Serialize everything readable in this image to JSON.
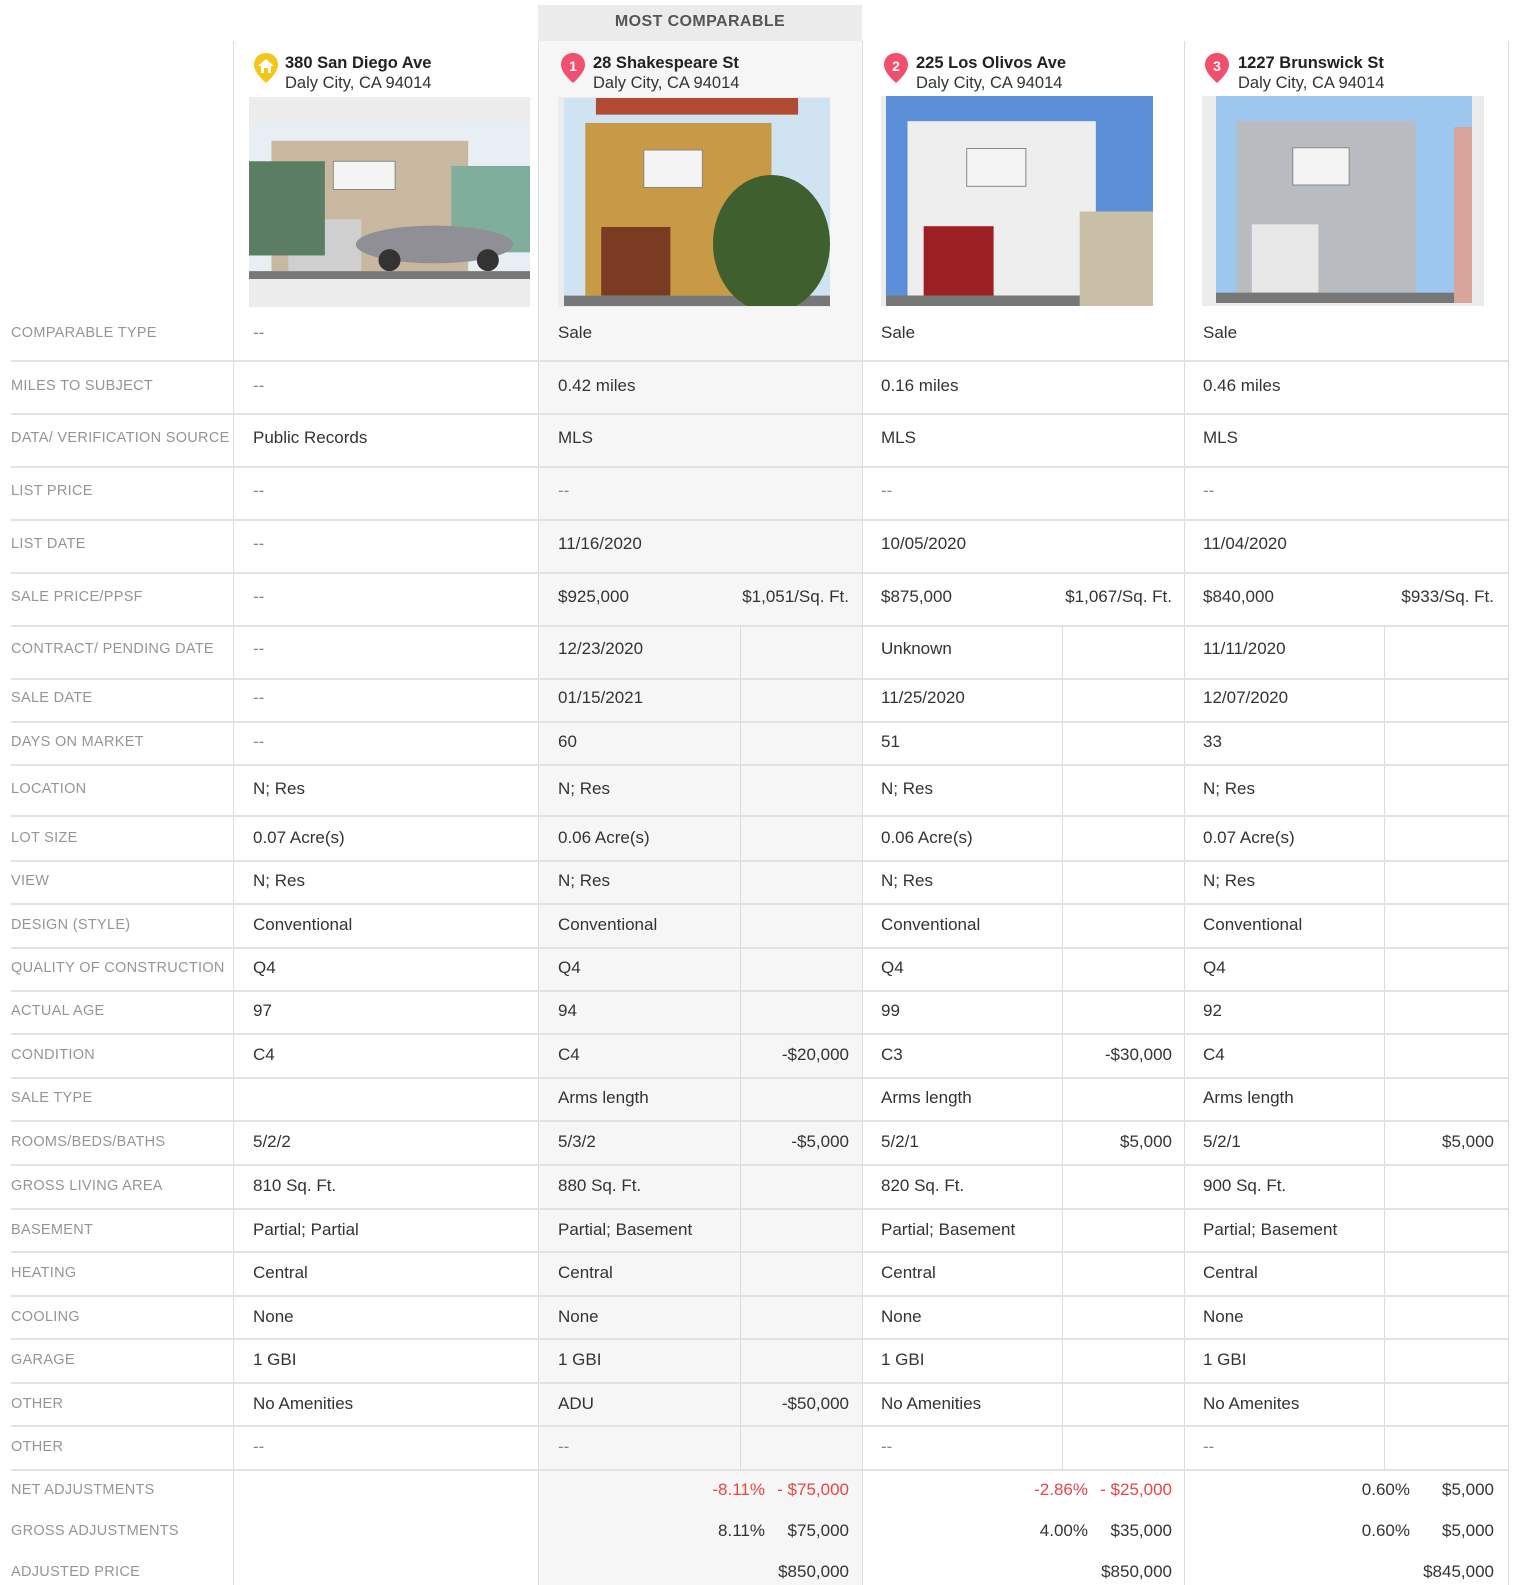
{
  "highlight_label": "MOST COMPARABLE",
  "properties": [
    {
      "marker": "home",
      "street": "380 San Diego Ave",
      "city": "Daly City, CA 94014",
      "photo": "photo of gray house with car parked in front",
      "marker_color": "#f5c518"
    },
    {
      "marker": "1",
      "street": "28 Shakespeare St",
      "city": "Daly City, CA 94014",
      "photo": "photo of tan stucco house with tree",
      "marker_color": "#f0506e"
    },
    {
      "marker": "2",
      "street": "225 Los Olivos Ave",
      "city": "Daly City, CA 94014",
      "photo": "photo of white stucco house with red garage",
      "marker_color": "#f0506e"
    },
    {
      "marker": "3",
      "street": "1227 Brunswick St",
      "city": "Daly City, CA 94014",
      "photo": "photo of gray two-story house",
      "marker_color": "#f0506e"
    }
  ],
  "rows": [
    {
      "label": "COMPARABLE TYPE",
      "cells": [
        {
          "v": "--"
        },
        {
          "v": "Sale"
        },
        {
          "v": "Sale"
        },
        {
          "v": "Sale"
        }
      ],
      "split": false
    },
    {
      "label": "MILES TO SUBJECT",
      "cells": [
        {
          "v": "--"
        },
        {
          "v": "0.42 miles"
        },
        {
          "v": "0.16 miles"
        },
        {
          "v": "0.46 miles"
        }
      ],
      "split": false
    },
    {
      "label": "DATA/ VERIFICATION SOURCE",
      "cells": [
        {
          "v": "Public Records"
        },
        {
          "v": "MLS"
        },
        {
          "v": "MLS"
        },
        {
          "v": "MLS"
        }
      ],
      "split": false
    },
    {
      "label": "LIST PRICE",
      "cells": [
        {
          "v": "--"
        },
        {
          "v": "--"
        },
        {
          "v": "--"
        },
        {
          "v": "--"
        }
      ],
      "split": false
    },
    {
      "label": "LIST DATE",
      "cells": [
        {
          "v": "--"
        },
        {
          "v": "11/16/2020"
        },
        {
          "v": "10/05/2020"
        },
        {
          "v": "11/04/2020"
        }
      ],
      "split": false
    },
    {
      "label": "SALE PRICE/PPSF",
      "cells": [
        {
          "v": "--"
        },
        {
          "v": "$925,000",
          "a": "$1,051/Sq. Ft."
        },
        {
          "v": "$875,000",
          "a": "$1,067/Sq. Ft."
        },
        {
          "v": "$840,000",
          "a": "$933/Sq. Ft."
        }
      ],
      "split": false
    },
    {
      "label": "CONTRACT/ PENDING DATE",
      "cells": [
        {
          "v": "--"
        },
        {
          "v": "12/23/2020"
        },
        {
          "v": "Unknown"
        },
        {
          "v": "11/11/2020"
        }
      ],
      "split": true
    },
    {
      "label": "SALE DATE",
      "cells": [
        {
          "v": "--"
        },
        {
          "v": "01/15/2021"
        },
        {
          "v": "11/25/2020"
        },
        {
          "v": "12/07/2020"
        }
      ],
      "split": true
    },
    {
      "label": "DAYS ON MARKET",
      "cells": [
        {
          "v": "--"
        },
        {
          "v": "60"
        },
        {
          "v": "51"
        },
        {
          "v": "33"
        }
      ],
      "split": true
    },
    {
      "label": "LOCATION",
      "cells": [
        {
          "v": "N; Res"
        },
        {
          "v": "N; Res"
        },
        {
          "v": "N; Res"
        },
        {
          "v": "N; Res"
        }
      ],
      "split": true
    },
    {
      "label": "LOT SIZE",
      "cells": [
        {
          "v": "0.07 Acre(s)"
        },
        {
          "v": "0.06 Acre(s)"
        },
        {
          "v": "0.06 Acre(s)"
        },
        {
          "v": "0.07 Acre(s)"
        }
      ],
      "split": true
    },
    {
      "label": "VIEW",
      "cells": [
        {
          "v": "N; Res"
        },
        {
          "v": "N; Res"
        },
        {
          "v": "N; Res"
        },
        {
          "v": "N; Res"
        }
      ],
      "split": true
    },
    {
      "label": "DESIGN (STYLE)",
      "cells": [
        {
          "v": "Conventional"
        },
        {
          "v": "Conventional"
        },
        {
          "v": "Conventional"
        },
        {
          "v": "Conventional"
        }
      ],
      "split": true
    },
    {
      "label": "QUALITY OF CONSTRUCTION",
      "cells": [
        {
          "v": "Q4"
        },
        {
          "v": "Q4"
        },
        {
          "v": "Q4"
        },
        {
          "v": "Q4"
        }
      ],
      "split": true
    },
    {
      "label": "ACTUAL AGE",
      "cells": [
        {
          "v": "97"
        },
        {
          "v": "94"
        },
        {
          "v": "99"
        },
        {
          "v": "92"
        }
      ],
      "split": true
    },
    {
      "label": "CONDITION",
      "cells": [
        {
          "v": "C4"
        },
        {
          "v": "C4",
          "a": "-$20,000"
        },
        {
          "v": "C3",
          "a": "-$30,000"
        },
        {
          "v": "C4"
        }
      ],
      "split": true
    },
    {
      "label": "SALE TYPE",
      "cells": [
        {
          "v": ""
        },
        {
          "v": "Arms length"
        },
        {
          "v": "Arms length"
        },
        {
          "v": "Arms length"
        }
      ],
      "split": true
    },
    {
      "label": "ROOMS/BEDS/BATHS",
      "cells": [
        {
          "v": "5/2/2"
        },
        {
          "v": "5/3/2",
          "a": "-$5,000"
        },
        {
          "v": "5/2/1",
          "a": "$5,000"
        },
        {
          "v": "5/2/1",
          "a": "$5,000"
        }
      ],
      "split": true
    },
    {
      "label": "GROSS LIVING AREA",
      "cells": [
        {
          "v": "810 Sq. Ft."
        },
        {
          "v": "880 Sq. Ft."
        },
        {
          "v": "820 Sq. Ft."
        },
        {
          "v": "900 Sq. Ft."
        }
      ],
      "split": true
    },
    {
      "label": "BASEMENT",
      "cells": [
        {
          "v": "Partial; Partial"
        },
        {
          "v": "Partial; Basement"
        },
        {
          "v": "Partial; Basement"
        },
        {
          "v": "Partial; Basement"
        }
      ],
      "split": true
    },
    {
      "label": "HEATING",
      "cells": [
        {
          "v": "Central"
        },
        {
          "v": "Central"
        },
        {
          "v": "Central"
        },
        {
          "v": "Central"
        }
      ],
      "split": true
    },
    {
      "label": "COOLING",
      "cells": [
        {
          "v": "None"
        },
        {
          "v": "None"
        },
        {
          "v": "None"
        },
        {
          "v": "None"
        }
      ],
      "split": true
    },
    {
      "label": "GARAGE",
      "cells": [
        {
          "v": "1 GBI"
        },
        {
          "v": "1 GBI"
        },
        {
          "v": "1 GBI"
        },
        {
          "v": "1 GBI"
        }
      ],
      "split": true
    },
    {
      "label": "OTHER",
      "cells": [
        {
          "v": "No Amenities"
        },
        {
          "v": "ADU",
          "a": "-$50,000"
        },
        {
          "v": "No Amenities"
        },
        {
          "v": "No Amenites"
        }
      ],
      "split": true
    },
    {
      "label": "OTHER",
      "cells": [
        {
          "v": "--"
        },
        {
          "v": "--"
        },
        {
          "v": "--"
        },
        {
          "v": "--"
        }
      ],
      "split": true
    }
  ],
  "summary": [
    {
      "label": "NET ADJUSTMENTS",
      "cells": [
        {
          "pct": "",
          "amt": ""
        },
        {
          "pct": "-8.11%",
          "amt": "- $75,000",
          "neg": true
        },
        {
          "pct": "-2.86%",
          "amt": "- $25,000",
          "neg": true
        },
        {
          "pct": "0.60%",
          "amt": "$5,000",
          "neg": false
        }
      ]
    },
    {
      "label": "GROSS ADJUSTMENTS",
      "cells": [
        {
          "pct": "",
          "amt": ""
        },
        {
          "pct": "8.11%",
          "amt": "$75,000",
          "neg": false
        },
        {
          "pct": "4.00%",
          "amt": "$35,000",
          "neg": false
        },
        {
          "pct": "0.60%",
          "amt": "$5,000",
          "neg": false
        }
      ]
    },
    {
      "label": "ADJUSTED PRICE",
      "cells": [
        {
          "pct": "",
          "amt": ""
        },
        {
          "pct": "",
          "amt": "$850,000",
          "neg": false
        },
        {
          "pct": "",
          "amt": "$850,000",
          "neg": false
        },
        {
          "pct": "",
          "amt": "$845,000",
          "neg": false
        }
      ]
    }
  ],
  "colors": {
    "highlight_bg": "#f6f6f6",
    "highlight_header": "#ebebeb",
    "negative": "#e84545",
    "label": "#959595"
  }
}
